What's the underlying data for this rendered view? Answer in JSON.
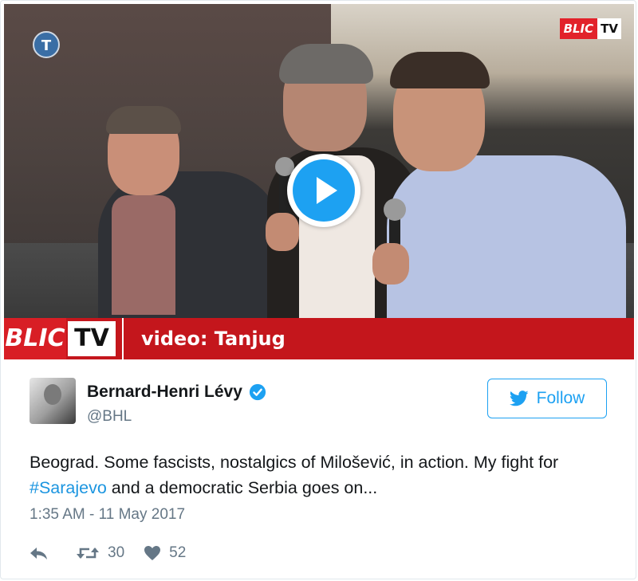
{
  "video": {
    "channel_badge": "T",
    "brand_mini": {
      "blic": "BLIC",
      "tv": "TV"
    },
    "caption": {
      "blic": "BLIC",
      "tv": "TV",
      "text": "video: Tanjug"
    }
  },
  "tweet": {
    "author_name": "Bernard-Henri Lévy",
    "handle": "@BHL",
    "follow_label": "Follow",
    "text_before": "Beograd. Some fascists, nostalgics of Milošević, in action. My fight for ",
    "hashtag": "#Sarajevo",
    "text_after": " and a democratic Serbia goes on...",
    "timestamp": "1:35 AM - 11 May 2017",
    "retweets": "30",
    "likes": "52"
  },
  "icons": [
    "play-icon",
    "verified-icon",
    "twitter-bird-icon",
    "reply-icon",
    "retweet-icon",
    "like-icon"
  ],
  "colors": {
    "accent": "#1da1f2",
    "blic_red": "#c4161c",
    "text": "#14171a",
    "muted": "#657786"
  }
}
